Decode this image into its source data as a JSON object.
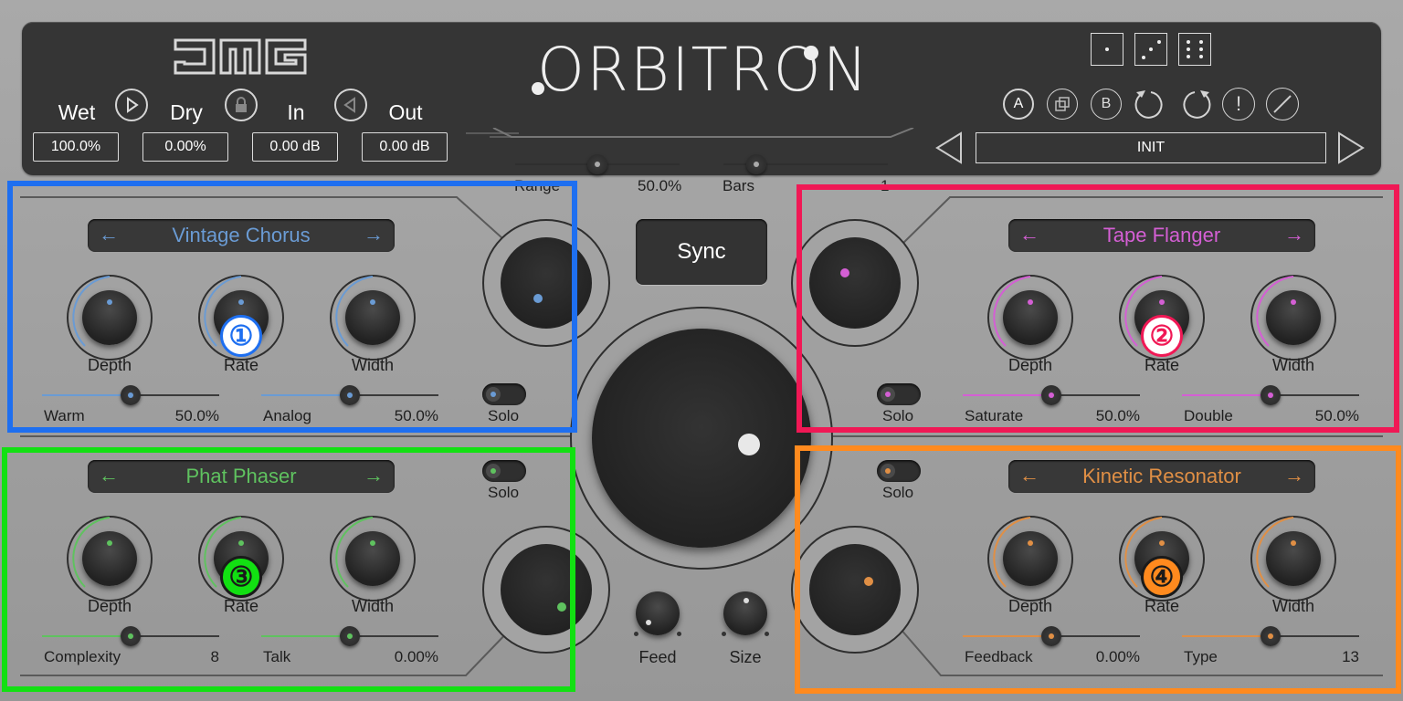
{
  "app": {
    "title": "ORBITRON"
  },
  "io": [
    {
      "label": "Wet",
      "value": "100.0%"
    },
    {
      "label": "Dry",
      "value": "0.00%"
    },
    {
      "label": "In",
      "value": "0.00 dB"
    },
    {
      "label": "Out",
      "value": "0.00 dB"
    }
  ],
  "toolbar": {
    "a": "A",
    "b": "B",
    "warn": "!"
  },
  "preset": {
    "name": "INIT"
  },
  "center": {
    "range_label": "Range",
    "range_value": "50.0%",
    "range_level": 0.5,
    "bars_label": "Bars",
    "bars_value": "1",
    "sync_label": "Sync",
    "feed_label": "Feed",
    "size_label": "Size"
  },
  "modules": [
    {
      "name": "Vintage Chorus",
      "color": "#6a9bd4",
      "badge": "①",
      "knobs": [
        "Depth",
        "Rate",
        "Width"
      ],
      "slider1": {
        "label": "Warm",
        "value": "50.0%",
        "level": 0.5
      },
      "slider2": {
        "label": "Analog",
        "value": "50.0%",
        "level": 0.5
      },
      "solo": "Solo"
    },
    {
      "name": "Tape Flanger",
      "color": "#d45fd4",
      "badge": "②",
      "knobs": [
        "Depth",
        "Rate",
        "Width"
      ],
      "slider1": {
        "label": "Saturate",
        "value": "50.0%",
        "level": 0.5
      },
      "slider2": {
        "label": "Double",
        "value": "50.0%",
        "level": 0.5
      },
      "solo": "Solo"
    },
    {
      "name": "Phat Phaser",
      "color": "#5fc25f",
      "badge": "③",
      "knobs": [
        "Depth",
        "Rate",
        "Width"
      ],
      "slider1": {
        "label": "Complexity",
        "value": "8",
        "level": 0.5
      },
      "slider2": {
        "label": "Talk",
        "value": "0.00%",
        "level": 0.5
      },
      "solo": "Solo"
    },
    {
      "name": "Kinetic Resonator",
      "color": "#e08f45",
      "badge": "④",
      "knobs": [
        "Depth",
        "Rate",
        "Width"
      ],
      "slider1": {
        "label": "Feedback",
        "value": "0.00%",
        "level": 0.5
      },
      "slider2": {
        "label": "Type",
        "value": "13",
        "level": 0.5
      },
      "solo": "Solo"
    }
  ],
  "frames": {
    "m1": "#1e6ff0",
    "m2": "#f01855",
    "m3": "#12e012",
    "m4": "#ff8a1e"
  }
}
